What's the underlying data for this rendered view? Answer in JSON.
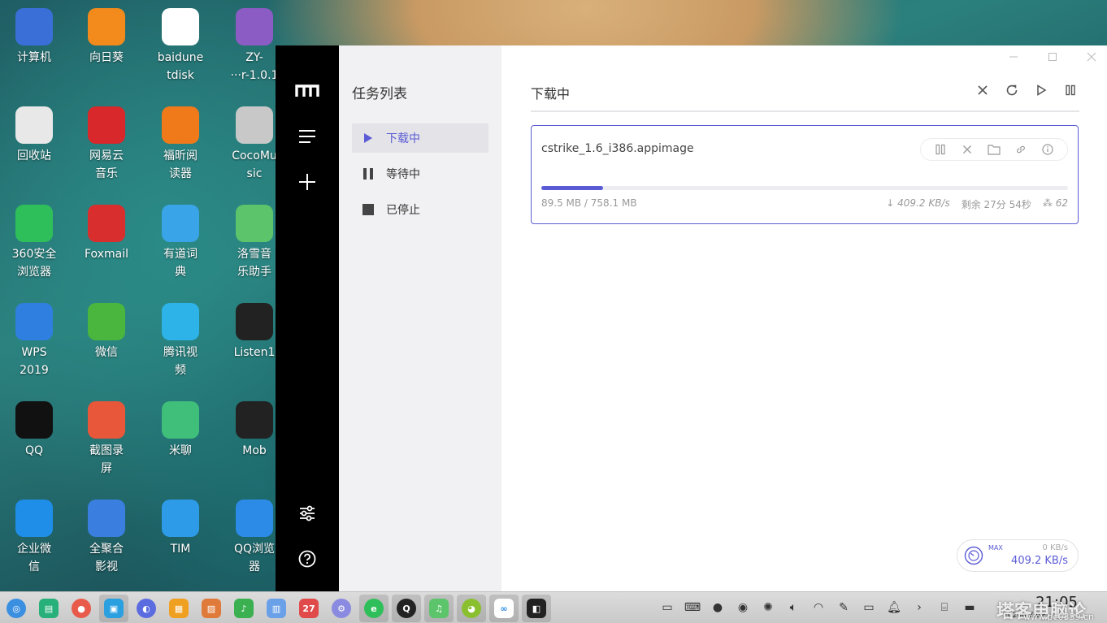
{
  "desktop": {
    "icons": [
      {
        "label": "计算机",
        "icon": "computer-icon",
        "color": "#3a6fd8"
      },
      {
        "label": "回收站",
        "icon": "trash-icon",
        "color": "#e8e8e8"
      },
      {
        "label": "360安全\n浏览器",
        "icon": "360-browser-icon",
        "color": "#2fbf5a"
      },
      {
        "label": "WPS\n2019",
        "icon": "wps-icon",
        "color": "#2f7fe0"
      },
      {
        "label": "QQ",
        "icon": "qq-icon",
        "color": "#111111"
      },
      {
        "label": "企业微\n信",
        "icon": "wework-icon",
        "color": "#1f8ee8"
      },
      {
        "label": "向日葵",
        "icon": "sunflower-icon",
        "color": "#f28a1c"
      },
      {
        "label": "网易云\n音乐",
        "icon": "netease-music-icon",
        "color": "#d8282b"
      },
      {
        "label": "Foxmail",
        "icon": "foxmail-icon",
        "color": "#d82e2e"
      },
      {
        "label": "微信",
        "icon": "wechat-icon",
        "color": "#4ab63d"
      },
      {
        "label": "截图录\n屏",
        "icon": "screenshot-icon",
        "color": "#e8573a"
      },
      {
        "label": "全聚合\n影视",
        "icon": "video-icon",
        "color": "#3a7fe0"
      },
      {
        "label": "baidune\ntdisk",
        "icon": "baidu-disk-icon",
        "color": "#ffffff"
      },
      {
        "label": "福昕阅\n读器",
        "icon": "foxit-icon",
        "color": "#f07a1a"
      },
      {
        "label": "有道词\n典",
        "icon": "youdao-icon",
        "color": "#3aa4e8"
      },
      {
        "label": "腾讯视\n频",
        "icon": "tencent-video-icon",
        "color": "#2db3e8"
      },
      {
        "label": "米聊",
        "icon": "miliao-icon",
        "color": "#3fbf7a"
      },
      {
        "label": "TIM",
        "icon": "tim-icon",
        "color": "#2d9be8"
      },
      {
        "label": "ZY-\n···r-1.0.1",
        "icon": "file-icon",
        "color": "#8b5cc4"
      },
      {
        "label": "CocoMu\nsic",
        "icon": "music-icon",
        "color": "#c8c8c8"
      },
      {
        "label": "洛雪音\n乐助手",
        "icon": "lx-music-icon",
        "color": "#5cc46a"
      },
      {
        "label": "Listen1",
        "icon": "listen1-icon",
        "color": "#222222"
      },
      {
        "label": "Mob",
        "icon": "mob-icon",
        "color": "#222222"
      },
      {
        "label": "QQ浏览\n器",
        "icon": "qq-browser-icon",
        "color": "#2d8be8"
      }
    ]
  },
  "app": {
    "sidebar_title": "任务列表",
    "nav": [
      {
        "label": "下载中",
        "icon": "play-icon",
        "active": true
      },
      {
        "label": "等待中",
        "icon": "pause-icon",
        "active": false
      },
      {
        "label": "已停止",
        "icon": "stop-icon",
        "active": false
      }
    ],
    "header_title": "下载中",
    "task": {
      "filename": "cstrike_1.6_i386.appimage",
      "size": "89.5 MB / 758.1 MB",
      "progress": 0.118,
      "speed": "↓ 409.2 KB/s",
      "remaining": "剩余 27分 54秒",
      "connections": "62"
    },
    "speed_meter": {
      "max_label": "MAX",
      "upload": "0 KB/s",
      "download": "409.2 KB/s"
    },
    "accent": "#5b5bd6"
  },
  "taskbar": {
    "time": "21:05",
    "date": "2020/07/09",
    "watermark": "塔客电脑论坛",
    "watermark_url": "www.pc0359.cn"
  }
}
